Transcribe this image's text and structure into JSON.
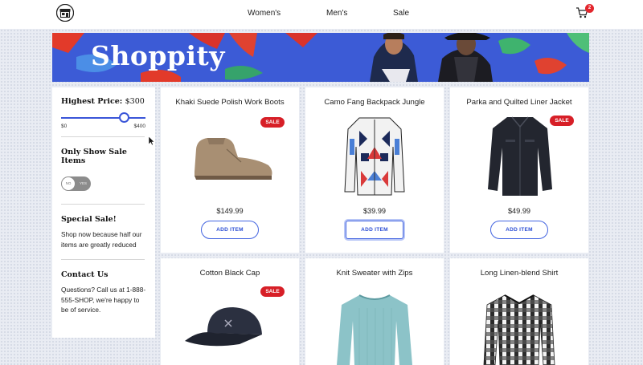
{
  "nav": {
    "links": [
      "Women's",
      "Men's",
      "Sale"
    ],
    "cart_count": "2",
    "brand_color": "#3c5bd6",
    "logo_icon": "storefront-icon",
    "cart_icon": "cart-icon"
  },
  "hero": {
    "title": "Shoppity"
  },
  "sidebar": {
    "price_heading": "Highest Price:",
    "price_value": "$300",
    "price_level_fraction": 0.75,
    "slider_min": "$0",
    "slider_max": "$400",
    "sale_heading": "Only Show Sale Items",
    "toggle_on": "NO",
    "toggle_off": "YES",
    "special_heading": "Special Sale!",
    "special_text": "Shop now because half our items are greatly reduced",
    "contact_heading": "Contact Us",
    "contact_text": "Questions? Call us at 1-888-555-SHOP, we're happy to be of service."
  },
  "products": [
    {
      "title": "Khaki Suede Polish Work Boots",
      "price": "$149.99",
      "sale": true,
      "button": "ADD ITEM"
    },
    {
      "title": "Camo Fang Backpack Jungle",
      "price": "$39.99",
      "sale": false,
      "button": "ADD ITEM"
    },
    {
      "title": "Parka and Quilted Liner Jacket",
      "price": "$49.99",
      "sale": true,
      "button": "ADD ITEM"
    },
    {
      "title": "Cotton Black Cap",
      "price": "",
      "sale": true,
      "button": ""
    },
    {
      "title": "Knit Sweater with Zips",
      "price": "",
      "sale": false,
      "button": ""
    },
    {
      "title": "Long Linen-blend Shirt",
      "price": "",
      "sale": false,
      "button": ""
    }
  ],
  "sale_label": "SALE",
  "colors": {
    "accent": "#3a55d8",
    "sale": "#d71f27"
  }
}
